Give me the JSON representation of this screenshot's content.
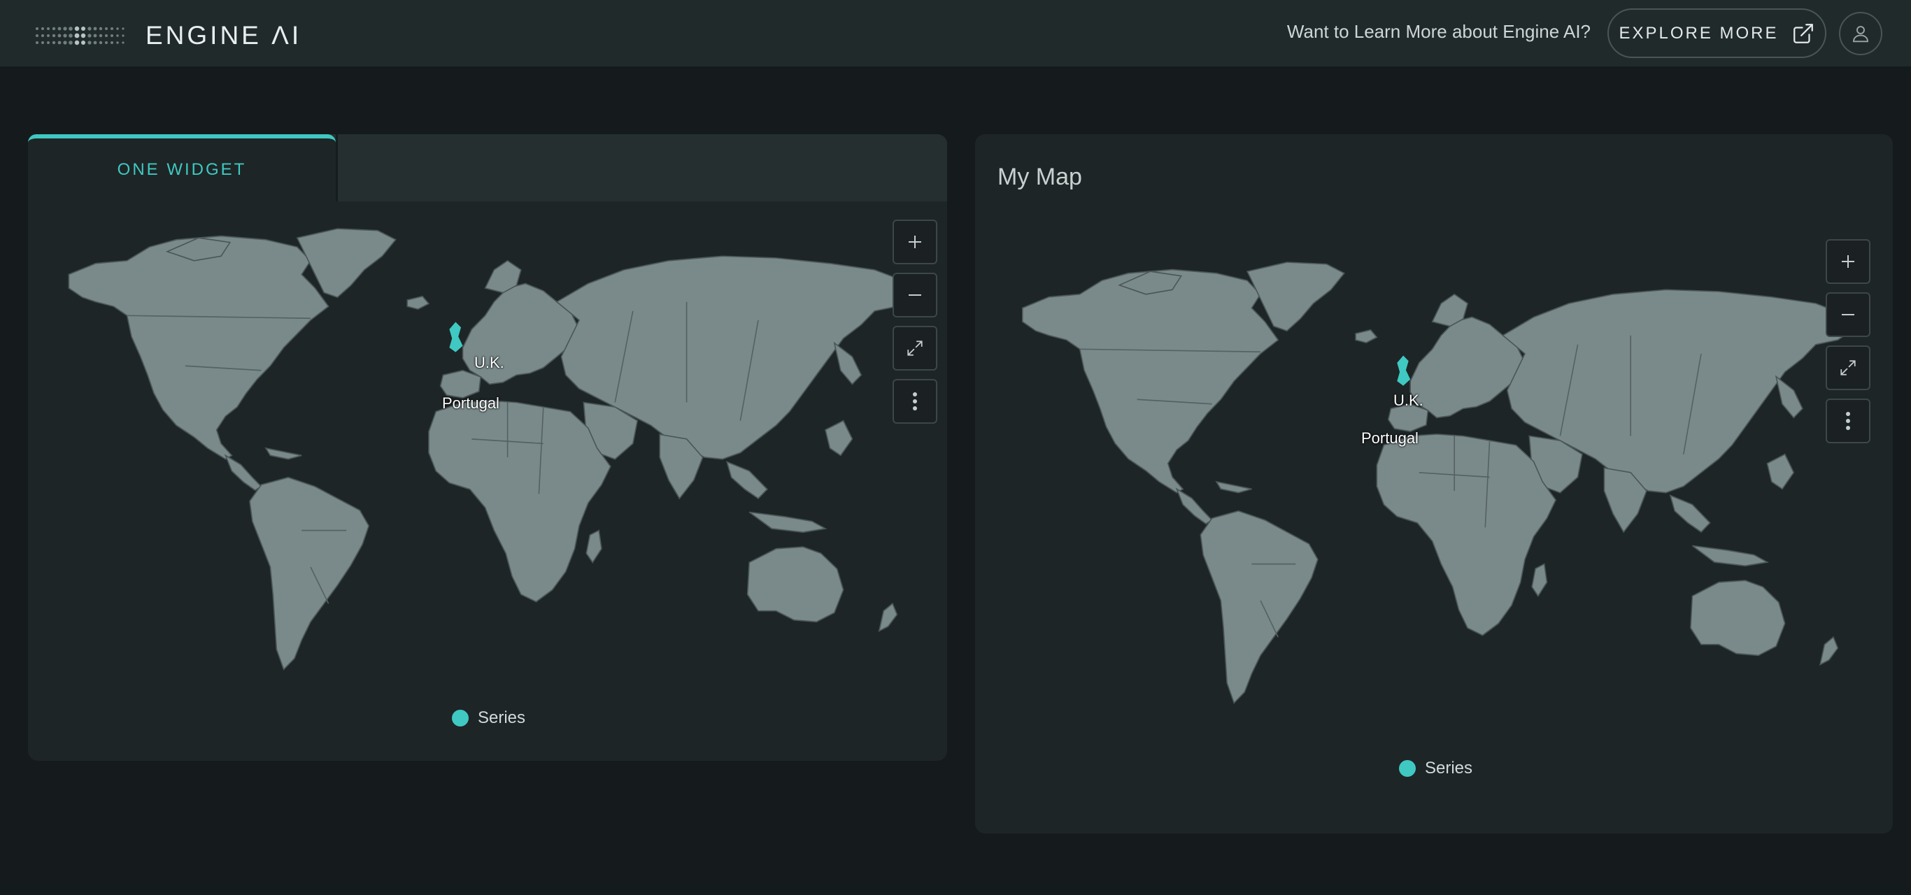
{
  "header": {
    "brand": "ENGINE ΛI",
    "prompt": "Want to Learn More about Engine AI?",
    "explore_label": "EXPLORE MORE",
    "explore_icon": "external-link-icon",
    "avatar_icon": "user-icon"
  },
  "left_widget": {
    "tab_label": "ONE WIDGET",
    "labels": {
      "uk": "U.K.",
      "portugal": "Portugal"
    },
    "legend": "Series"
  },
  "right_widget": {
    "title": "My Map",
    "labels": {
      "uk": "U.K.",
      "portugal": "Portugal"
    },
    "legend": "Series"
  },
  "controls": [
    "zoom-in",
    "zoom-out",
    "fullscreen",
    "more-options"
  ],
  "colors": {
    "accent": "#3fc9c2",
    "land": "#7a8a8b",
    "background": "#151b1c",
    "card": "#1e2526",
    "header": "#212a2b"
  }
}
